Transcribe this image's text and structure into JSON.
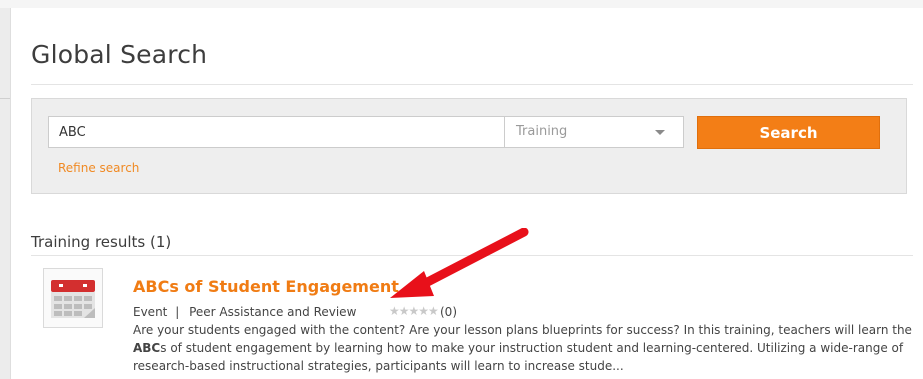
{
  "page": {
    "title": "Global Search"
  },
  "search": {
    "query_value": "ABC",
    "type_selected": "Training",
    "button_label": "Search",
    "refine_label": "Refine search"
  },
  "results": {
    "heading": "Training results (1)",
    "items": [
      {
        "title_highlight": "ABC",
        "title_rest": "s of Student Engagement",
        "type": "Event",
        "separator": "|",
        "category": "Peer Assistance and Review",
        "stars": "★★★★★",
        "rating_count": "(0)",
        "description_part1": "Are your students engaged with the content? Are your lesson plans blueprints for success?  In this training, teachers will learn the ",
        "description_highlight": "ABC",
        "description_part2": "s of student engagement by learning how to make your instruction student and learning-centered. Utilizing a wide-range of research-based instructional strategies, participants will learn to increase stude..."
      }
    ]
  },
  "colors": {
    "accent": "#f37e16",
    "link": "#f07c14",
    "annotation": "#e8101a"
  }
}
